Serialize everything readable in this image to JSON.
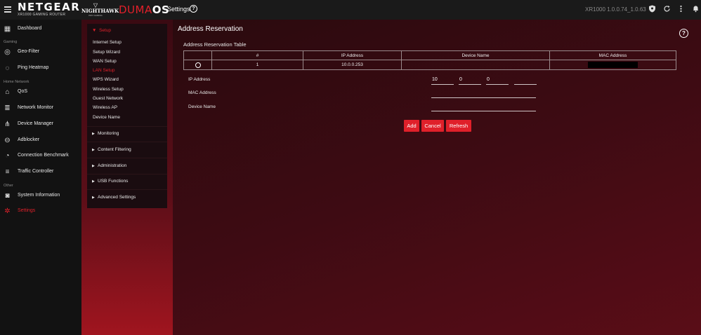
{
  "topbar": {
    "brand": "NETGEAR",
    "brand_sub": "XR1000 GAMING ROUTER",
    "nighthawk": "NIGHTHAWK",
    "nighthawk_sub": "PRO GAMING",
    "duma_a": "DUMA",
    "duma_b": "OS",
    "section": "Settings",
    "version": "XR1000 1.0.0.74_1.0.63",
    "icons": [
      "menu-icon",
      "help-icon",
      "shield-icon",
      "refresh-icon",
      "more-icon",
      "bell-icon"
    ]
  },
  "leftnav": {
    "dashboard": "Dashboard",
    "section_gaming": "Gaming",
    "geofilter": "Geo-Filter",
    "ping_heatmap": "Ping Heatmap",
    "section_home": "Home Network",
    "qos": "QoS",
    "network_monitor": "Network Monitor",
    "device_manager": "Device Manager",
    "adblocker": "Adblocker",
    "connection_benchmark": "Connection Benchmark",
    "traffic_controller": "Traffic Controller",
    "section_other": "Other",
    "system_information": "System Information",
    "settings": "Settings"
  },
  "subnav": {
    "setup": "Setup",
    "links": [
      "Internet Setup",
      "Setup Wizard",
      "WAN Setup",
      "LAN Setup",
      "WPS Wizard",
      "Wireless Setup",
      "Guest Network",
      "Wireless AP",
      "Device Name"
    ],
    "groups": [
      "Monitoring",
      "Content Filtering",
      "Administration",
      "USB Functions",
      "Advanced Settings"
    ]
  },
  "main": {
    "title": "Address Reservation",
    "table_title": "Address Reservation Table",
    "columns": [
      "#",
      "IP Address",
      "Device Name",
      "MAC Address"
    ],
    "rows": [
      {
        "num": "1",
        "ip": "10.0.0.253",
        "device_name": "",
        "mac": ""
      }
    ],
    "form": {
      "ip_label": "IP Address",
      "ip_1": "10",
      "ip_2": "0",
      "ip_3": "0",
      "ip_4": "",
      "mac_label": "MAC Address",
      "mac_value": "",
      "device_label": "Device Name",
      "device_value": ""
    },
    "buttons": {
      "add": "Add",
      "cancel": "Cancel",
      "refresh": "Refresh"
    }
  },
  "colors": {
    "accent": "#e0202a",
    "topbar": "#1a1a1a",
    "nav": "#121212"
  }
}
